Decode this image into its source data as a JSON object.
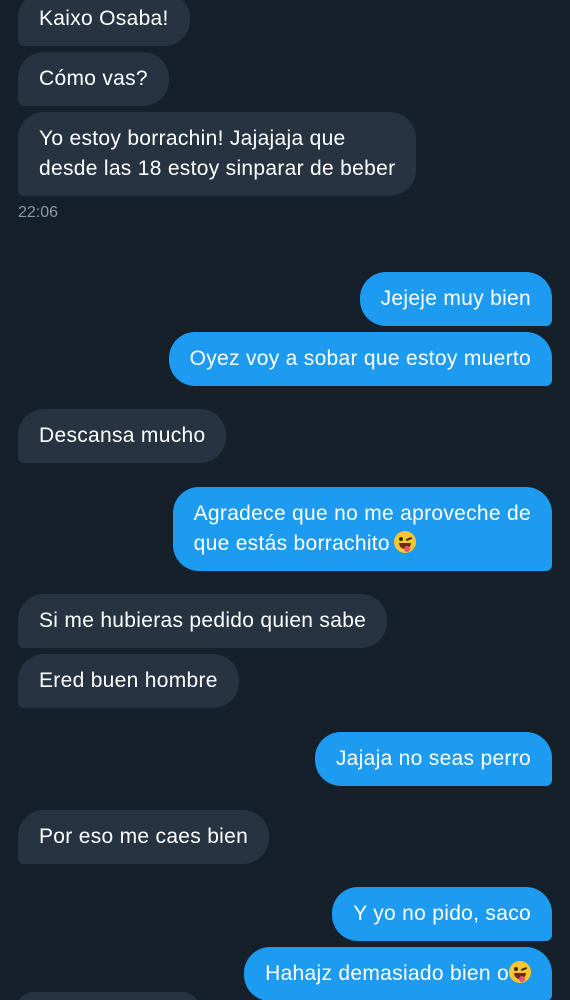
{
  "conversation": {
    "timestamp": "22:06",
    "messages": [
      {
        "id": "m1",
        "side": "in",
        "text": "Kaixo Osaba!"
      },
      {
        "id": "m2",
        "side": "in",
        "text": "Cómo vas?"
      },
      {
        "id": "m3",
        "side": "in",
        "lines": [
          "Yo estoy borrachin! Jajajaja que",
          "desde las 18 estoy sinparar de beber"
        ]
      },
      {
        "id": "m4",
        "side": "out",
        "text": "Jejeje muy bien"
      },
      {
        "id": "m5",
        "side": "out",
        "text": "Oyez voy a sobar que estoy muerto"
      },
      {
        "id": "m6",
        "side": "in",
        "text": "Descansa mucho"
      },
      {
        "id": "m7",
        "side": "out",
        "lines": [
          "Agradece que no me aproveche de",
          "que estás borrachito"
        ],
        "emoji": "winking-face-with-tongue"
      },
      {
        "id": "m8",
        "side": "in",
        "text": "Si me hubieras pedido quien sabe"
      },
      {
        "id": "m9",
        "side": "in",
        "text": "Ered buen hombre"
      },
      {
        "id": "m10",
        "side": "out",
        "text": "Jajaja no seas perro"
      },
      {
        "id": "m11",
        "side": "in",
        "text": "Por eso me caes bien"
      },
      {
        "id": "m12",
        "side": "out",
        "text": "Y yo no pido, saco"
      },
      {
        "id": "m13",
        "side": "out",
        "text": "Hahajz demasiado bien o",
        "emoji": "winking-face-with-tongue"
      }
    ]
  },
  "colors": {
    "background": "#15202b",
    "incoming_bubble": "#273340",
    "outgoing_bubble": "#1d9bf0",
    "timestamp_text": "#8b98a5"
  }
}
